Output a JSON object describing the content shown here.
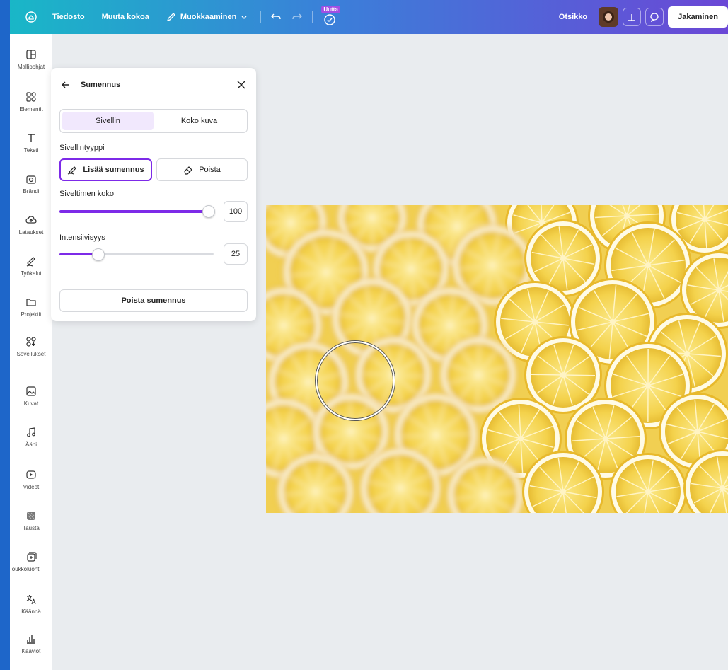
{
  "topbar": {
    "menu": [
      "Tiedosto",
      "Muuta kokoa",
      "Muokkaaminen"
    ],
    "new_badge": "Uutta",
    "doc_title": "Otsikko",
    "share_label": "Jakaminen"
  },
  "rail": {
    "items": [
      {
        "label": "Mallipohjat",
        "icon": "template-icon"
      },
      {
        "label": "Elementit",
        "icon": "elements-icon"
      },
      {
        "label": "Teksti",
        "icon": "text-icon"
      },
      {
        "label": "Brändi",
        "icon": "brand-icon"
      },
      {
        "label": "Lataukset",
        "icon": "upload-cloud-icon"
      },
      {
        "label": "Työkalut",
        "icon": "draw-icon"
      },
      {
        "label": "Projektit",
        "icon": "folder-icon"
      },
      {
        "label": "Sovellukset",
        "icon": "apps-icon"
      },
      {
        "label": "Kuvat",
        "icon": "image-icon"
      },
      {
        "label": "Ääni",
        "icon": "music-icon"
      },
      {
        "label": "Videot",
        "icon": "video-icon"
      },
      {
        "label": "Tausta",
        "icon": "background-icon"
      },
      {
        "label": "oukkoluonti",
        "icon": "bulk-create-icon"
      },
      {
        "label": "Käännä",
        "icon": "translate-icon"
      },
      {
        "label": "Kaaviot",
        "icon": "chart-icon"
      }
    ]
  },
  "panel": {
    "title": "Sumennus",
    "tabs": [
      "Sivellin",
      "Koko kuva"
    ],
    "active_tab": "Sivellin",
    "brush_type_label": "Sivellintyyppi",
    "brush_add": "Lisää sumennus",
    "brush_erase": "Poista",
    "size_label": "Siveltimen koko",
    "size_value": "100",
    "size_fraction": 1.0,
    "intensity_label": "Intensiivisyys",
    "intensity_value": "25",
    "intensity_fraction": 0.25,
    "remove_label": "Poista sumennus"
  },
  "colors": {
    "accent": "#7d2ae8",
    "topbar_start": "#19b7c7",
    "topbar_end": "#6b47d6",
    "lemon": "#f4d24c",
    "lemon_light": "#fbe98a",
    "rind": "#fffbe6"
  }
}
